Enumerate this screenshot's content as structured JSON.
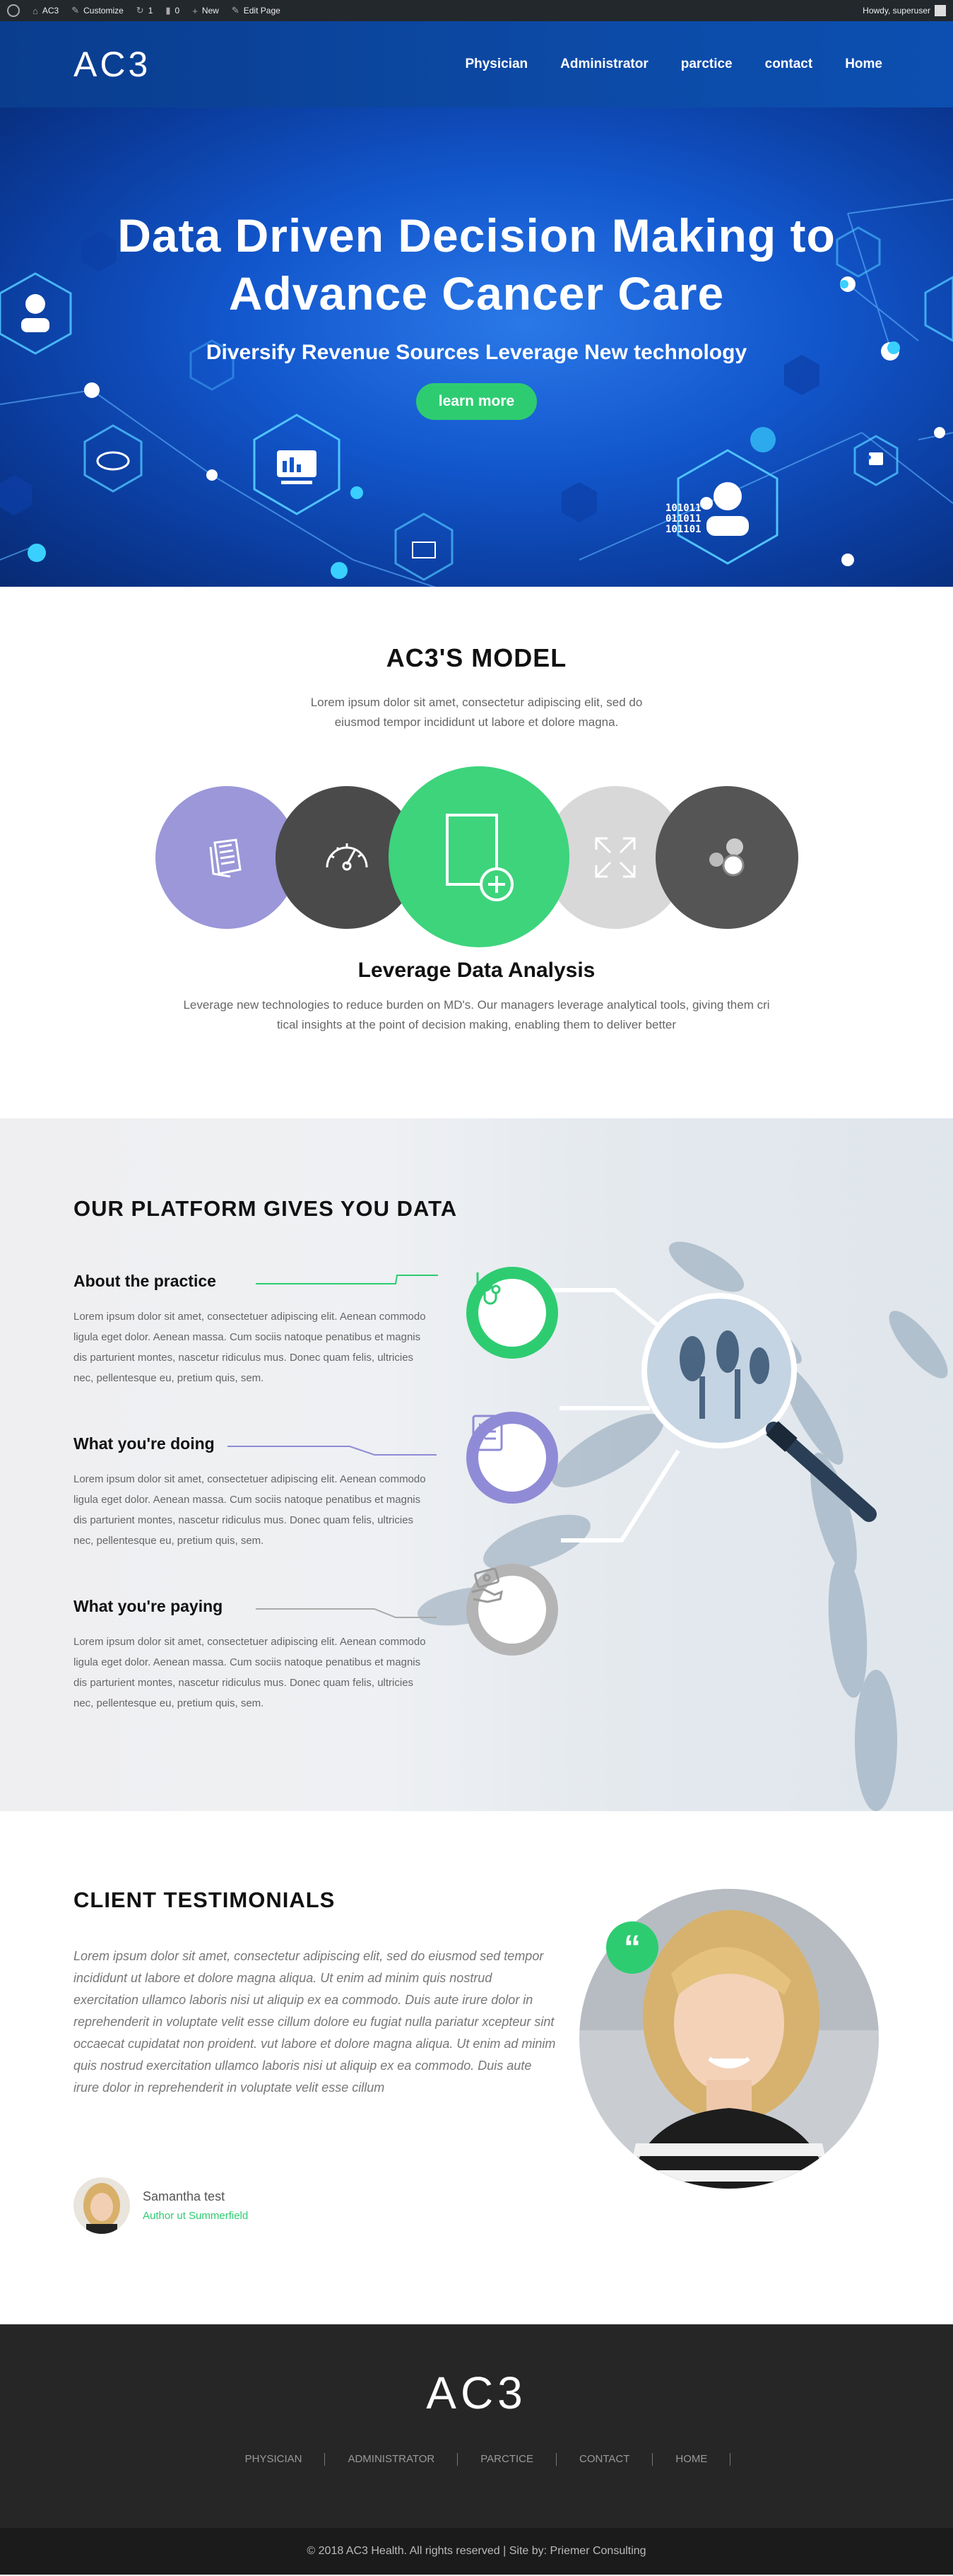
{
  "admin_bar": {
    "site": "AC3",
    "customize": "Customize",
    "updates": "1",
    "comments": "0",
    "new": "New",
    "edit_page": "Edit Page",
    "howdy": "Howdy, superuser"
  },
  "header": {
    "logo": "AC3",
    "nav": [
      "Physician",
      "Administrator",
      "parctice",
      "contact",
      "Home"
    ]
  },
  "hero": {
    "title_line1": "Data Driven Decision Making to",
    "title_line2": "Advance Cancer Care",
    "subtitle": "Diversify Revenue Sources Leverage New technology",
    "cta": "learn more",
    "binary": [
      "101011",
      "011011",
      "101101"
    ]
  },
  "model": {
    "title": "AC3'S MODEL",
    "intro": "Lorem ipsum dolor sit amet, consectetur adipiscing elit, sed do eiusmod tempor incididunt ut labore et dolore magna.",
    "active_title": "Leverage Data Analysis",
    "active_desc": "Leverage new technologies to reduce burden on MD's. Our managers leverage analytical tools, giving them cri tical insights at the point of decision making, enabling them to deliver better",
    "circles": [
      {
        "icon": "documents-icon",
        "color": "#9b97d9"
      },
      {
        "icon": "speedometer-icon",
        "color": "#4a4a4a"
      },
      {
        "icon": "add-document-icon",
        "color": "#3dd47c"
      },
      {
        "icon": "expand-icon",
        "color": "#d8d8d8"
      },
      {
        "icon": "bubbles-icon",
        "color": "#555555"
      }
    ]
  },
  "platform": {
    "title": "OUR PLATFORM GIVES YOU DATA",
    "features": [
      {
        "title": "About the practice",
        "text": "Lorem ipsum dolor sit amet, consectetuer adipiscing elit. Aenean commodo ligula eget dolor. Aenean massa. Cum sociis natoque penatibus et magnis dis parturient montes, nascetur ridiculus mus. Donec quam felis, ultricies nec, pellentesque eu, pretium quis, sem.",
        "color": "#2ecc71",
        "icon": "stethoscope-icon"
      },
      {
        "title": "What you're doing",
        "text": "Lorem ipsum dolor sit amet, consectetuer adipiscing elit. Aenean commodo ligula eget dolor. Aenean massa. Cum sociis natoque penatibus et magnis dis parturient montes, nascetur ridiculus mus. Donec quam felis, ultricies nec, pellentesque eu, pretium quis, sem.",
        "color": "#8f8bd6",
        "icon": "checklist-icon"
      },
      {
        "title": "What you're paying",
        "text": "Lorem ipsum dolor sit amet, consectetuer adipiscing elit. Aenean commodo ligula eget dolor. Aenean massa. Cum sociis natoque penatibus et magnis dis parturient montes, nascetur ridiculus mus. Donec quam felis, ultricies nec, pellentesque eu, pretium quis, sem.",
        "color": "#aaaaaa",
        "icon": "money-hand-icon"
      }
    ]
  },
  "testimonials": {
    "title": "CLIENT TESTIMONIALS",
    "quote": "Lorem ipsum dolor sit amet, consectetur adipiscing elit, sed do eiusmod sed tempor incididunt ut labore et dolore magna aliqua. Ut enim ad minim quis nostrud exercitation ullamco laboris nisi ut aliquip ex ea commodo. Duis aute irure dolor in reprehenderit in voluptate velit esse cillum dolore eu fugiat nulla pariatur xcepteur sint occaecat cupidatat non proident. vut labore et dolore magna aliqua. Ut enim ad minim quis nostrud exercitation ullamco laboris nisi ut aliquip ex ea commodo. Duis aute irure dolor in reprehenderit in voluptate velit esse cillum",
    "author_name": "Samantha test",
    "author_role": "Author ut Summerfield",
    "quote_mark": "“"
  },
  "footer": {
    "logo": "AC3",
    "nav": [
      "PHYSICIAN",
      "ADMINISTRATOR",
      "PARCTICE",
      "CONTACT",
      "HOME"
    ],
    "copyright": "© 2018 AC3 Health. All rights reserved | Site by: Priemer Consulting"
  },
  "colors": {
    "green": "#2ecc71",
    "purple": "#8f8bd6",
    "blue": "#0c4aa6",
    "dark": "#262626"
  }
}
